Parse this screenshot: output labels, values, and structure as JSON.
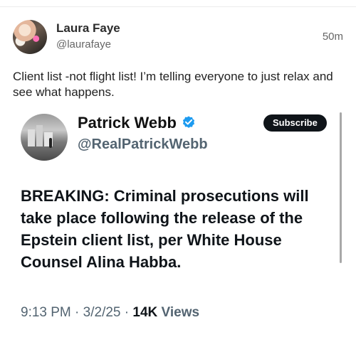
{
  "post": {
    "author_name": "Laura Faye",
    "author_handle": "@laurafaye",
    "timestamp": "50m",
    "text": "Client list -not flight list! I’m telling everyone to just relax and see what happens."
  },
  "embedded_post": {
    "author_name": "Patrick Webb",
    "author_handle": "@RealPatrickWebb",
    "verified_icon": "verified-badge-icon",
    "subscribe_label": "Subscribe",
    "headline": "BREAKING: Criminal prosecutions will take place following the release of the Epstein client list, per White House Counsel Alina Habba.",
    "time": "9:13 PM",
    "separator": " · ",
    "date": "3/2/25",
    "views_count": "14K",
    "views_label": "Views"
  },
  "colors": {
    "verified": "#1d9bf0",
    "subscribe_bg": "#0f1419",
    "secondary_text": "#536471"
  }
}
